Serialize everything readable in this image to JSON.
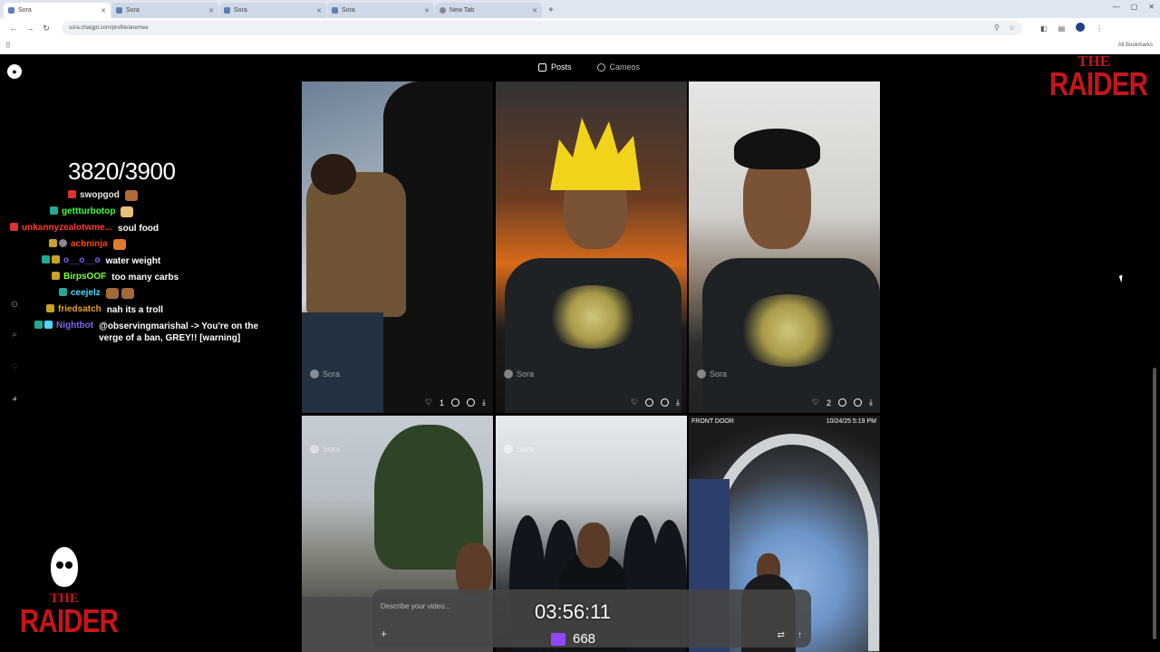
{
  "browser": {
    "tabs": [
      {
        "label": "Sora",
        "active": true
      },
      {
        "label": "Sora",
        "active": false
      },
      {
        "label": "Sora",
        "active": false
      },
      {
        "label": "Sora",
        "active": false
      },
      {
        "label": "New Tab",
        "active": false
      }
    ],
    "url": "sora.chatgpt.com/profile/anemea",
    "all_bookmarks": "All Bookmarks"
  },
  "site": {
    "tabs": [
      {
        "label": "Posts",
        "active": true
      },
      {
        "label": "Cameos",
        "active": false
      }
    ],
    "watermark": "Sora",
    "posts": [
      {
        "likes": "1",
        "kind": "anime"
      },
      {
        "likes": "",
        "kind": "ssj"
      },
      {
        "likes": "2",
        "kind": "smile"
      },
      {
        "likes": "",
        "kind": "street"
      },
      {
        "likes": "",
        "kind": "hoods"
      },
      {
        "likes": "",
        "kind": "doorbell"
      }
    ],
    "doorbell": {
      "label": "FRONT DOOR",
      "timestamp": "10/24/25  5:19 PM"
    },
    "composer_placeholder": "Describe your video..."
  },
  "stream": {
    "counter": "3820/3900",
    "timer": "03:56:11",
    "viewers": "668",
    "brand_the": "THE",
    "brand_raider": "RAIDER",
    "accent": "#c8141b",
    "chat": [
      {
        "user": "swopgod",
        "color": "#e8e8e8",
        "message": ""
      },
      {
        "user": "gettturbotop",
        "color": "#3cff3c",
        "message": ""
      },
      {
        "user": "unkannyzealotwme...",
        "color": "#ff3a2e",
        "message": "soul food"
      },
      {
        "user": "acbninja",
        "color": "#ff4500",
        "message": ""
      },
      {
        "user": "o__o__o",
        "color": "#8a5cff",
        "message": "water weight"
      },
      {
        "user": "BirpsOOF",
        "color": "#7fff3b",
        "message": "too many carbs"
      },
      {
        "user": "ceejelz",
        "color": "#48d8ff",
        "message": ""
      },
      {
        "user": "friedsatch",
        "color": "#e8a020",
        "message": "nah its a troll"
      },
      {
        "user": "Nightbot",
        "color": "#7b68ee",
        "message": "@observingmarishal -> You're on the verge of a ban, GREY!! [warning]"
      }
    ]
  }
}
